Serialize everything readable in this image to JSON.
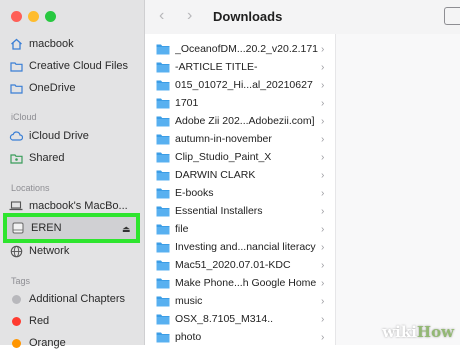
{
  "window": {
    "title": "Downloads"
  },
  "sidebar": {
    "favorites": [
      {
        "label": "macbook",
        "icon": "home-icon"
      },
      {
        "label": "Creative Cloud Files",
        "icon": "folder-icon"
      },
      {
        "label": "OneDrive",
        "icon": "folder-icon"
      }
    ],
    "icloud_header": "iCloud",
    "icloud": [
      {
        "label": "iCloud Drive",
        "icon": "cloud-icon"
      },
      {
        "label": "Shared",
        "icon": "shared-folder-icon"
      }
    ],
    "locations_header": "Locations",
    "locations": [
      {
        "label": "macbook's MacBo...",
        "icon": "laptop-icon"
      },
      {
        "label": "EREN",
        "icon": "drive-icon"
      },
      {
        "label": "Network",
        "icon": "globe-icon"
      }
    ],
    "tags_header": "Tags",
    "tags": [
      {
        "label": "Additional Chapters",
        "color": "#b8b8bc"
      },
      {
        "label": "Red",
        "color": "#ff3b30"
      },
      {
        "label": "Orange",
        "color": "#ff9500"
      }
    ]
  },
  "files": [
    "_OceanofDM...20.2_v20.2.171",
    "-ARTICLE TITLE-",
    "015_01072_Hi...al_20210627",
    "1701",
    "Adobe Zii 202...Adobezii.com]",
    "autumn-in-november",
    "Clip_Studio_Paint_X",
    "DARWIN CLARK",
    "E-books",
    "Essential Installers",
    "file",
    "Investing and...nancial literacy",
    "Mac51_2020.07.01-KDC",
    "Make Phone...h Google Home",
    "music",
    "OSX_8.7105_M314..",
    "photo"
  ],
  "colors": {
    "folder": "#3b9de6",
    "highlight": "#2ee52e"
  },
  "watermark": {
    "wiki": "wiki",
    "how": "How"
  }
}
